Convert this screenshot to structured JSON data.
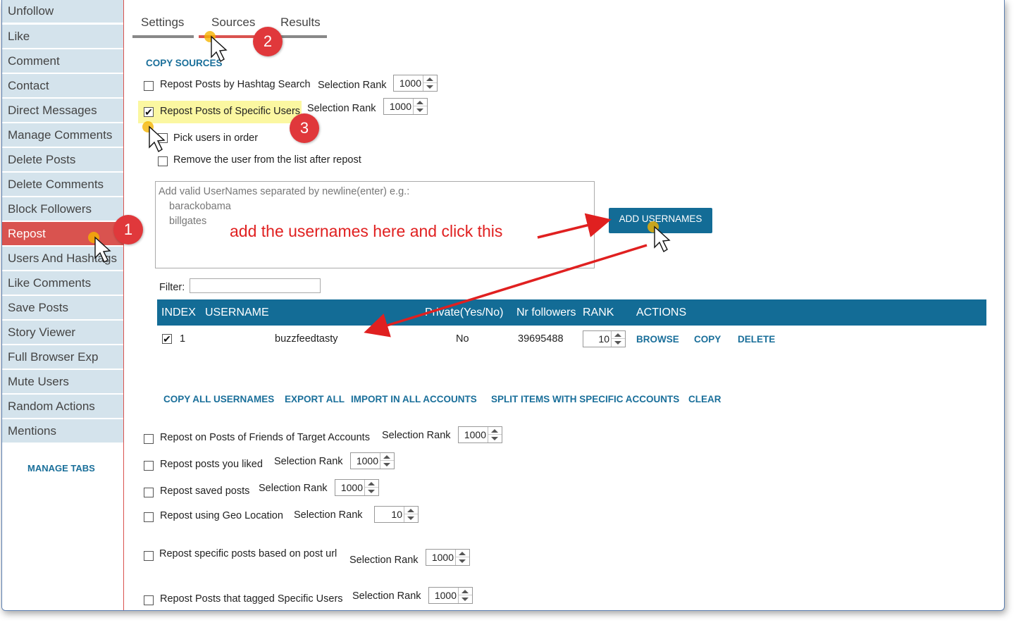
{
  "sidebar": {
    "items": [
      {
        "label": "Unfollow"
      },
      {
        "label": "Like"
      },
      {
        "label": "Comment"
      },
      {
        "label": "Contact"
      },
      {
        "label": "Direct Messages"
      },
      {
        "label": "Manage Comments"
      },
      {
        "label": "Delete Posts"
      },
      {
        "label": "Delete Comments"
      },
      {
        "label": "Block Followers"
      },
      {
        "label": "Repost",
        "active": true
      },
      {
        "label": "Users And Hashtags"
      },
      {
        "label": "Like Comments"
      },
      {
        "label": "Save Posts"
      },
      {
        "label": "Story Viewer"
      },
      {
        "label": "Full Browser Exp"
      },
      {
        "label": "Mute Users"
      },
      {
        "label": "Random Actions"
      },
      {
        "label": "Mentions"
      }
    ],
    "manage_tabs": "MANAGE TABS"
  },
  "tabs": [
    {
      "label": "Settings"
    },
    {
      "label": "Sources",
      "active": true
    },
    {
      "label": "Results"
    }
  ],
  "copy_sources": "COPY SOURCES",
  "selection_rank_label": "Selection Rank",
  "options_top": [
    {
      "label": "Repost Posts by Hashtag Search",
      "checked": false,
      "rank": "1000"
    },
    {
      "label": "Repost Posts of Specific Users",
      "checked": true,
      "rank": "1000"
    }
  ],
  "sub_options": [
    {
      "label": "Pick users in order",
      "checked": false
    },
    {
      "label": "Remove the user from the list after repost",
      "checked": false
    }
  ],
  "usernames_input": {
    "placeholder_line1": "Add valid UserNames separated by newline(enter) e.g.:",
    "placeholder_line2": "barackobama",
    "placeholder_line3": "billgates"
  },
  "add_usernames_button": "ADD USERNAMES",
  "filter_label": "Filter:",
  "filter_value": "",
  "table": {
    "headers": [
      "INDEX",
      "USERNAME",
      "Private(Yes/No)",
      "Nr followers",
      "RANK",
      "ACTIONS"
    ],
    "rows": [
      {
        "checked": true,
        "index": "1",
        "username": "buzzfeedtasty",
        "private": "No",
        "followers": "39695488",
        "rank": "10",
        "actions": [
          "BROWSE",
          "COPY",
          "DELETE"
        ]
      }
    ]
  },
  "bulk_actions": [
    "COPY ALL USERNAMES",
    "EXPORT ALL",
    "IMPORT IN ALL ACCOUNTS",
    "SPLIT ITEMS WITH SPECIFIC ACCOUNTS",
    "CLEAR"
  ],
  "options_bottom": [
    {
      "label": "Repost on Posts of Friends of Target Accounts",
      "checked": false,
      "rank": "1000"
    },
    {
      "label": "Repost posts you liked",
      "checked": false,
      "rank": "1000"
    },
    {
      "label": "Repost saved posts",
      "checked": false,
      "rank": "1000"
    },
    {
      "label": "Repost using Geo Location",
      "checked": false,
      "rank": "10"
    },
    {
      "label": "Repost specific posts based on post url",
      "checked": false,
      "rank": "1000"
    },
    {
      "label": "Repost Posts that tagged Specific Users",
      "checked": false,
      "rank": "1000"
    }
  ],
  "annotations": {
    "badge1": "1",
    "badge2": "2",
    "badge3": "3",
    "hint": "add the usernames here and click this"
  },
  "colors": {
    "accent": "#136c96",
    "active": "#d9534f",
    "annotation": "#e02020",
    "sidebar_bg": "#d4e3ec"
  }
}
